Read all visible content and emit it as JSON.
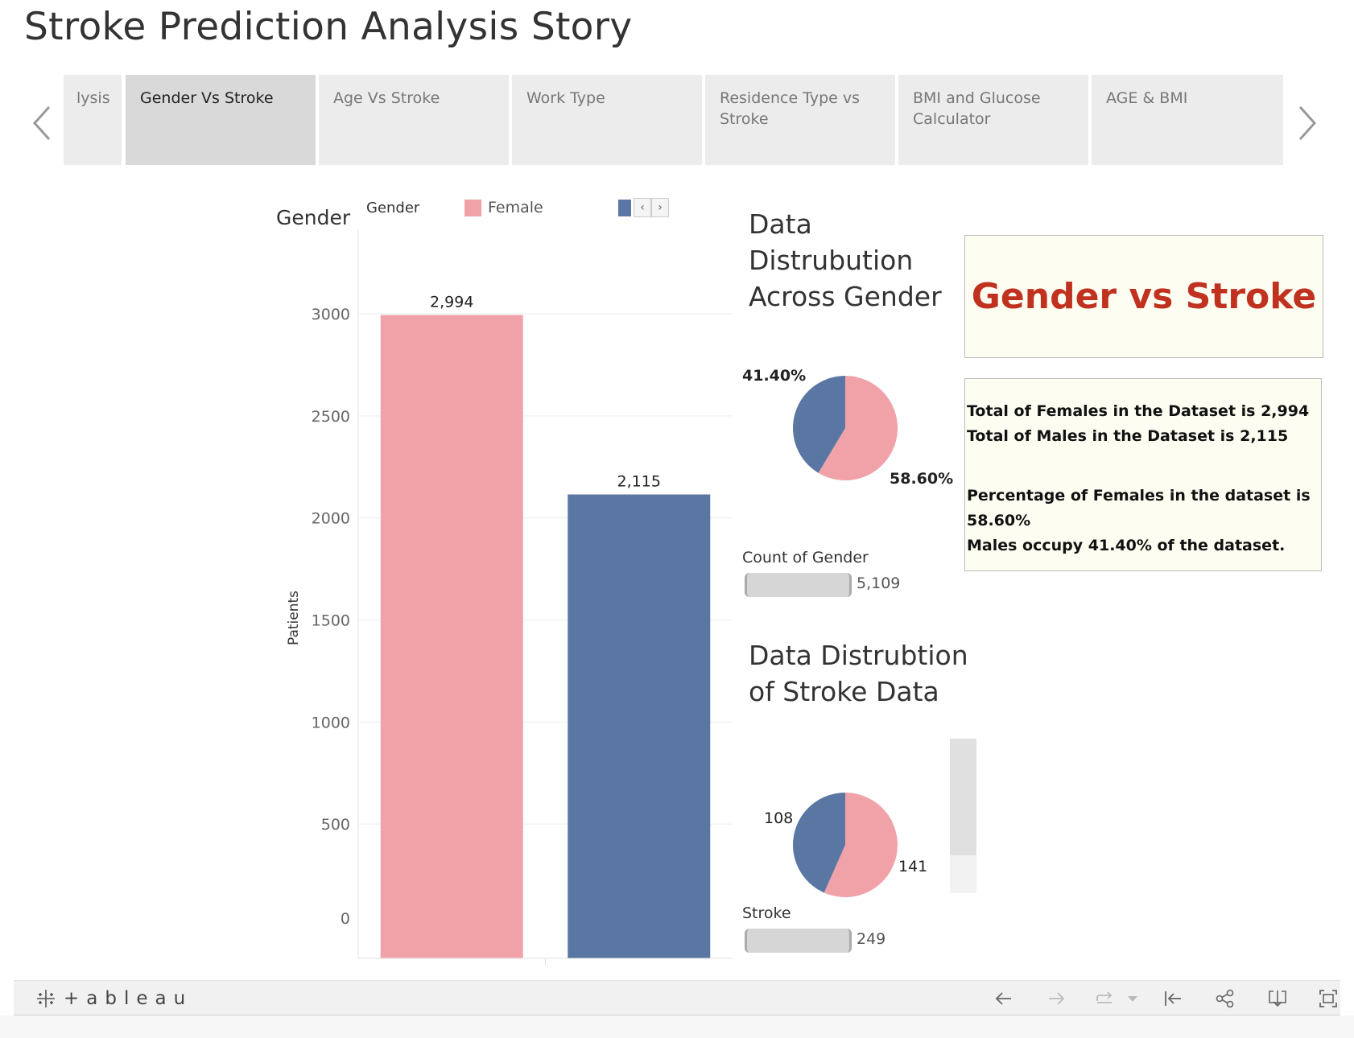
{
  "story": {
    "title": "Stroke Prediction Analysis Story"
  },
  "tabs": [
    {
      "label": "lysis",
      "active": false
    },
    {
      "label": "Gender Vs Stroke",
      "active": true
    },
    {
      "label": "Age Vs Stroke",
      "active": false
    },
    {
      "label": "Work Type",
      "active": false
    },
    {
      "label": "Residence Type vs Stroke",
      "active": false
    },
    {
      "label": "BMI and Glucose Calculator",
      "active": false
    },
    {
      "label": "AGE & BMI",
      "active": false
    }
  ],
  "legend": {
    "title": "Gender",
    "item_female": "Female"
  },
  "chart_data": {
    "type": "bar",
    "title": "",
    "header": "Gender",
    "categories": [
      "Female",
      "Male"
    ],
    "values": [
      2994,
      2115
    ],
    "value_labels": [
      "2,994",
      "2,115"
    ],
    "colors": [
      "#f0a2a8",
      "#5a77a3"
    ],
    "xlabel": "",
    "ylabel": "Patients",
    "ylim": [
      0,
      3000
    ],
    "yticks": [
      0,
      500,
      1000,
      1500,
      2000,
      2500,
      3000
    ],
    "grid": true
  },
  "gender_distribution": {
    "title_line1": "Data",
    "title_line2": "Distrubution",
    "title_line3": "Across Gender",
    "pie": {
      "type": "pie",
      "slices": [
        {
          "label": "Female",
          "value": 58.6,
          "text": "58.60%",
          "color": "#f0a2a8"
        },
        {
          "label": "Male",
          "value": 41.4,
          "text": "41.40%",
          "color": "#5a77a3"
        }
      ]
    },
    "count_label": "Count of Gender",
    "count_value": "5,109"
  },
  "stroke_distribution": {
    "title_line1": "Data Distrubtion",
    "title_line2": "of Stroke Data",
    "pie": {
      "type": "pie",
      "slices": [
        {
          "label": "Female",
          "value": 141,
          "text": "141",
          "color": "#f0a2a8"
        },
        {
          "label": "Male",
          "value": 108,
          "text": "108",
          "color": "#5a77a3"
        }
      ]
    },
    "count_label": "Stroke",
    "count_value": "249"
  },
  "title_box": {
    "text": "Gender vs Stroke",
    "color": "#c0321f"
  },
  "info_box": {
    "line1": "Total of Females in the Dataset is 2,994",
    "line2": "Total of Males in the Dataset is 2,115",
    "line3": "Percentage of Females in the dataset is",
    "line4": "58.60%",
    "line5": "Males occupy 41.40% of the dataset."
  },
  "footer": {
    "logo_text": "+ableau",
    "icons": [
      "undo-icon",
      "redo-icon",
      "revert-icon",
      "dropdown-icon",
      "reset-icon",
      "share-icon",
      "download-icon",
      "fullscreen-icon"
    ]
  }
}
